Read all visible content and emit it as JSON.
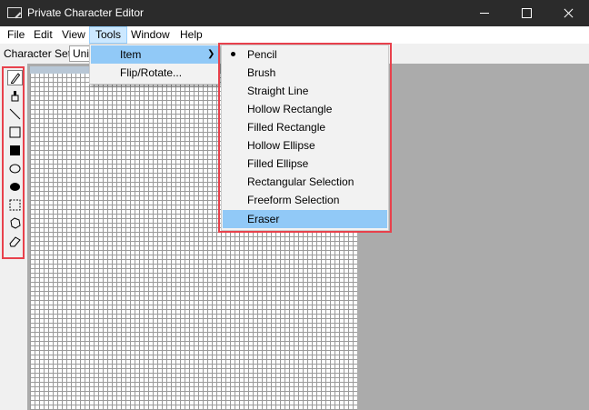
{
  "window": {
    "title": "Private Character Editor"
  },
  "menubar": {
    "items": [
      "File",
      "Edit",
      "View",
      "Tools",
      "Window",
      "Help"
    ]
  },
  "charset": {
    "label": "Character Set:",
    "value": "Unic"
  },
  "toolbox": {
    "tools": [
      "pencil-icon",
      "brush-icon",
      "straight-line-icon",
      "hollow-rectangle-icon",
      "filled-rectangle-icon",
      "hollow-ellipse-icon",
      "filled-ellipse-icon",
      "rectangular-selection-icon",
      "freeform-selection-icon",
      "eraser-icon"
    ]
  },
  "tools_menu": {
    "items": [
      {
        "label": "Item",
        "submenu": true
      },
      {
        "label": "Flip/Rotate...",
        "submenu": false
      }
    ]
  },
  "item_submenu": {
    "items": [
      "Pencil",
      "Brush",
      "Straight Line",
      "Hollow Rectangle",
      "Filled Rectangle",
      "Hollow Ellipse",
      "Filled Ellipse",
      "Rectangular Selection",
      "Freeform Selection",
      "Eraser"
    ],
    "checked": "Pencil",
    "highlighted": "Eraser"
  },
  "colors": {
    "highlight_annotation": "#e8414c",
    "menu_highlight": "#91c9f7",
    "titlebar": "#2b2b2b",
    "workspace": "#ababab"
  }
}
